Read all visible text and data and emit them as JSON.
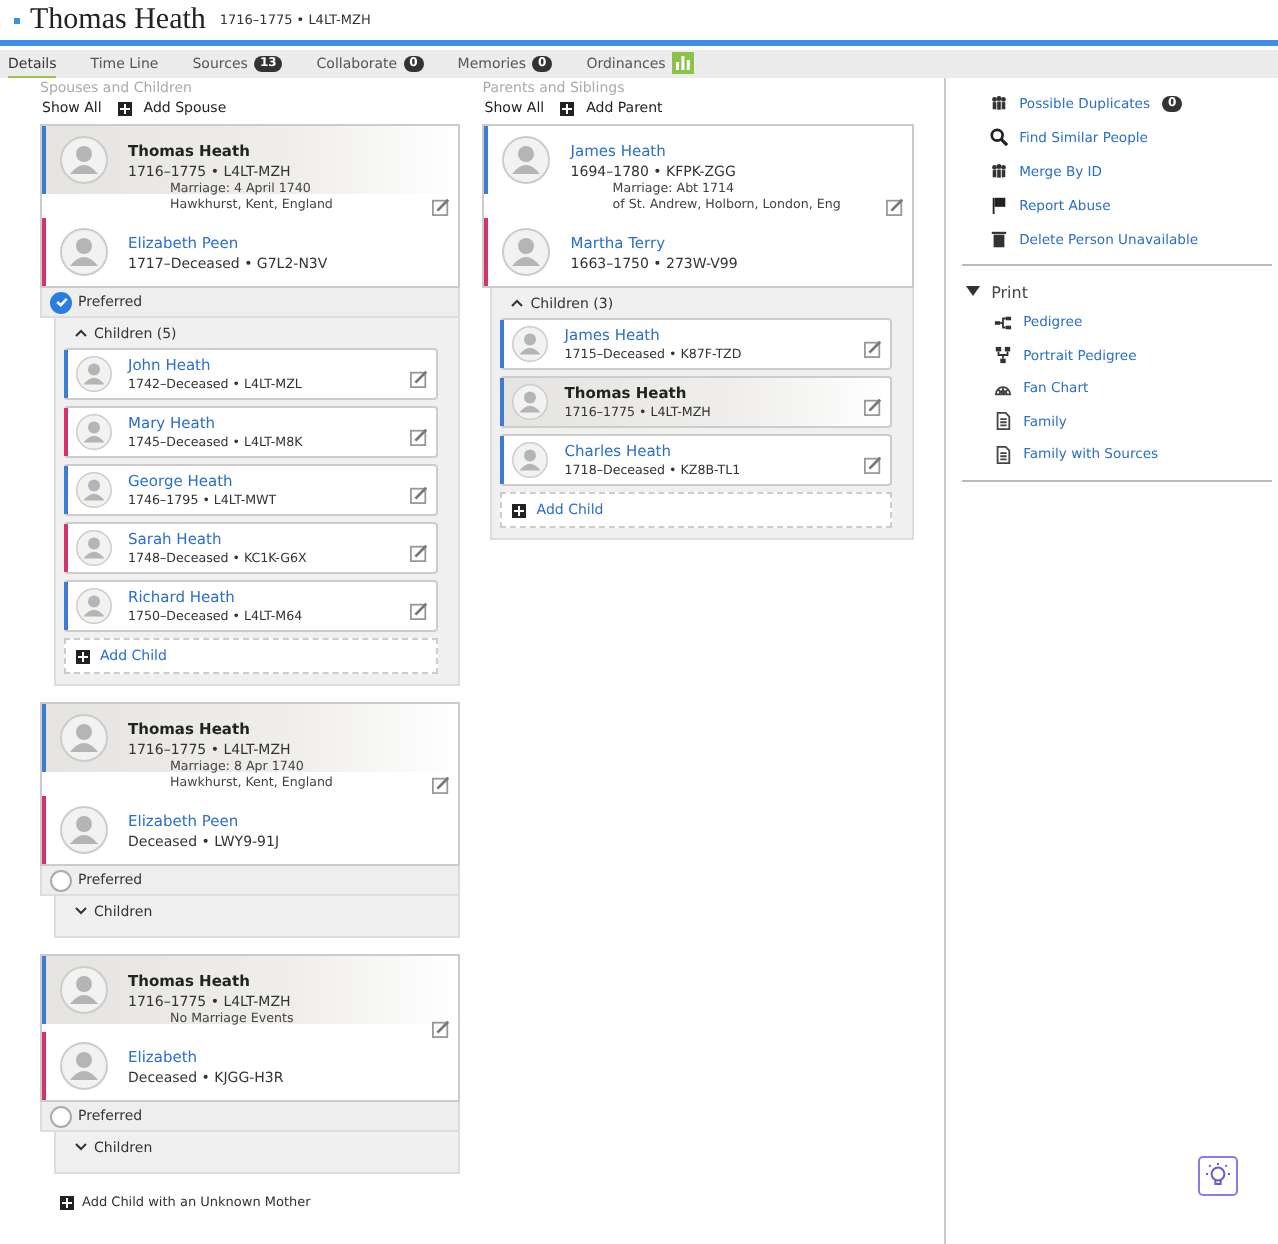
{
  "header": {
    "name": "Thomas Heath",
    "summary": "1716–1775 • L4LT-MZH"
  },
  "tabs": [
    {
      "label": "Details",
      "kind": "text",
      "selected": true
    },
    {
      "label": "Time Line",
      "kind": "text",
      "selected": false
    },
    {
      "label": "Sources",
      "count": "13",
      "kind": "count",
      "selected": false
    },
    {
      "label": "Collaborate",
      "count": "0",
      "kind": "count",
      "selected": false
    },
    {
      "label": "Memories",
      "count": "0",
      "kind": "count",
      "selected": false
    },
    {
      "label": "Ordinances",
      "kind": "icon",
      "selected": false
    }
  ],
  "spouses": {
    "title": "Spouses and Children",
    "show_all": "Show All",
    "add": "Add Spouse",
    "families": [
      {
        "husband": {
          "name": "Thomas Heath",
          "dates": "1716–1775 • L4LT-MZH",
          "color": "#3d7bd6",
          "current": true
        },
        "marriage": [
          "Marriage: 4 April 1740",
          "Hawkhurst, Kent, England"
        ],
        "wife": {
          "name": "Elizabeth Peen",
          "dates": "1717–Deceased • G7L2-N3V",
          "color": "#d6336c",
          "current": false
        },
        "preferred": true,
        "preferred_label": "Preferred",
        "expanded": true,
        "children_label": "Children (5)",
        "children": [
          {
            "name": "John Heath",
            "dates": "1742–Deceased • L4LT-MZL",
            "color": "#3d7bd6",
            "current": false
          },
          {
            "name": "Mary Heath",
            "dates": "1745–Deceased • L4LT-M8K",
            "color": "#d6336c",
            "current": false
          },
          {
            "name": "George Heath",
            "dates": "1746–1795 • L4LT-MWT",
            "color": "#3d7bd6",
            "current": false
          },
          {
            "name": "Sarah Heath",
            "dates": "1748–Deceased • KC1K-G6X",
            "color": "#d6336c",
            "current": false
          },
          {
            "name": "Richard Heath",
            "dates": "1750–Deceased • L4LT-M64",
            "color": "#3d7bd6",
            "current": false
          }
        ],
        "add_child": "Add Child"
      },
      {
        "husband": {
          "name": "Thomas Heath",
          "dates": "1716–1775 • L4LT-MZH",
          "color": "#3d7bd6",
          "current": true
        },
        "marriage": [
          "Marriage: 8 Apr 1740",
          "Hawkhurst, Kent, England"
        ],
        "wife": {
          "name": "Elizabeth Peen",
          "dates": "Deceased • LWY9-91J",
          "color": "#d6336c",
          "current": false
        },
        "preferred": false,
        "preferred_label": "Preferred",
        "expanded": false,
        "children_label": "Children"
      },
      {
        "husband": {
          "name": "Thomas Heath",
          "dates": "1716–1775 • L4LT-MZH",
          "color": "#3d7bd6",
          "current": true
        },
        "marriage": [
          "No Marriage Events"
        ],
        "wife": {
          "name": "Elizabeth",
          "dates": "Deceased • KJGG-H3R",
          "color": "#d6336c",
          "current": false
        },
        "preferred": false,
        "preferred_label": "Preferred",
        "expanded": false,
        "children_label": "Children"
      }
    ],
    "add_unknown_mother": "Add Child with an Unknown Mother"
  },
  "parents": {
    "title": "Parents and Siblings",
    "show_all": "Show All",
    "add": "Add Parent",
    "family": {
      "husband": {
        "name": "James Heath",
        "dates": "1694–1780 • KFPK-ZGG",
        "color": "#3d7bd6",
        "current": false
      },
      "marriage": [
        "Marriage: Abt 1714",
        "of St. Andrew, Holborn, London, Eng"
      ],
      "wife": {
        "name": "Martha Terry",
        "dates": "1663–1750 • 273W-V99",
        "color": "#d6336c",
        "current": false
      },
      "expanded": true,
      "children_label": "Children (3)",
      "children": [
        {
          "name": "James Heath",
          "dates": "1715–Deceased • K87F-TZD",
          "color": "#3d7bd6",
          "current": false
        },
        {
          "name": "Thomas Heath",
          "dates": "1716–1775 • L4LT-MZH",
          "color": "#3d7bd6",
          "current": true
        },
        {
          "name": "Charles Heath",
          "dates": "1718–Deceased • KZ8B-TL1",
          "color": "#3d7bd6",
          "current": false
        }
      ],
      "add_child": "Add Child"
    }
  },
  "sidebar": {
    "actions": [
      {
        "label": "Possible Duplicates",
        "count": "0",
        "kind": "duplicates"
      },
      {
        "label": "Find Similar People",
        "kind": "search"
      },
      {
        "label": "Merge By ID",
        "kind": "merge"
      },
      {
        "label": "Report Abuse",
        "kind": "report"
      },
      {
        "label": "Delete Person Unavailable",
        "kind": "delete"
      }
    ],
    "print_title": "Print",
    "print_expanded": true,
    "print_items": [
      {
        "label": "Pedigree",
        "kind": "pedigree"
      },
      {
        "label": "Portrait Pedigree",
        "kind": "portrait"
      },
      {
        "label": "Fan Chart",
        "kind": "fan"
      },
      {
        "label": "Family",
        "kind": "family"
      },
      {
        "label": "Family with Sources",
        "kind": "family"
      }
    ]
  }
}
